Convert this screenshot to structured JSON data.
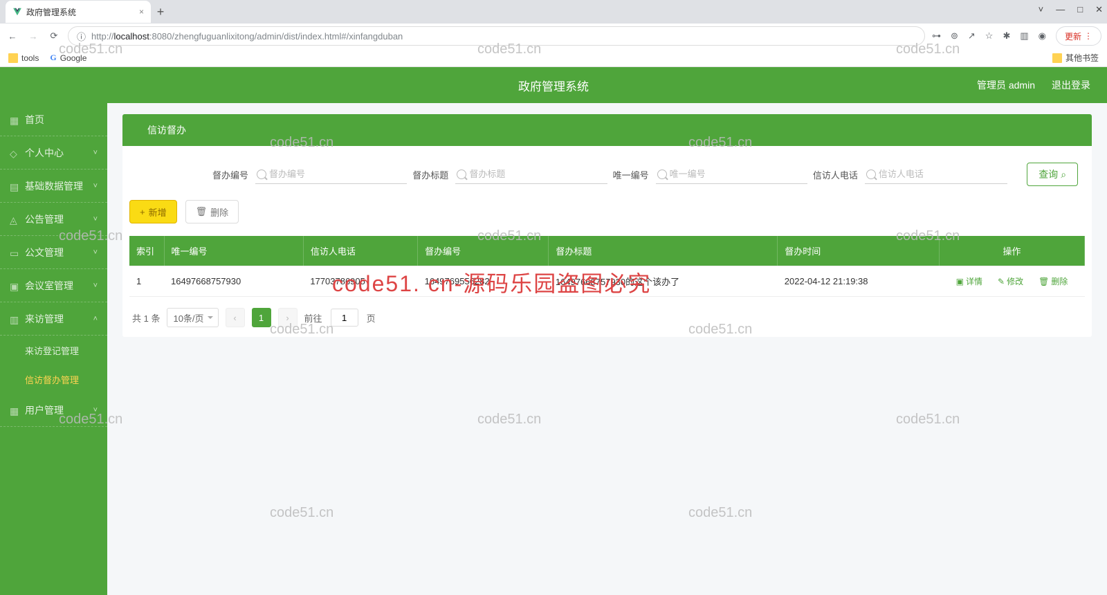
{
  "browser": {
    "tab_title": "政府管理系统",
    "new_tab": "+",
    "url_prefix": "http://",
    "url_host": "localhost",
    "url_port_path": ":8080/zhengfuguanlixitong/admin/dist/index.html#/xinfangduban",
    "bm_tools": "tools",
    "bm_google": "Google",
    "bm_other": "其他书签",
    "update": "更新",
    "win_min": "—",
    "win_max": "□",
    "win_close": "✕",
    "win_down": "˅"
  },
  "header": {
    "title": "政府管理系统",
    "role": "管理员 admin",
    "logout": "退出登录"
  },
  "sidebar": {
    "items": [
      {
        "label": "首页",
        "arrow": ""
      },
      {
        "label": "个人中心",
        "arrow": "˅"
      },
      {
        "label": "基础数据管理",
        "arrow": "˅"
      },
      {
        "label": "公告管理",
        "arrow": "˅"
      },
      {
        "label": "公文管理",
        "arrow": "˅"
      },
      {
        "label": "会议室管理",
        "arrow": "˅"
      },
      {
        "label": "来访管理",
        "arrow": "˄"
      },
      {
        "label": "用户管理",
        "arrow": "˅"
      }
    ],
    "sub": {
      "visit_reg": "来访登记管理",
      "petition": "信访督办管理"
    }
  },
  "panel": {
    "title": "信访督办"
  },
  "search": {
    "f1_label": "督办编号",
    "f1_ph": "督办编号",
    "f2_label": "督办标题",
    "f2_ph": "督办标题",
    "f3_label": "唯一编号",
    "f3_ph": "唯一编号",
    "f4_label": "信访人电话",
    "f4_ph": "信访人电话",
    "query": "查询"
  },
  "actions": {
    "add": "新增",
    "delete": "删除"
  },
  "table": {
    "headers": [
      "索引",
      "唯一编号",
      "信访人电话",
      "督办编号",
      "督办标题",
      "督办时间",
      "操作"
    ],
    "rows": [
      {
        "idx": "1",
        "uid": "16497668757930",
        "phone": "17703786905",
        "no": "1649769556282",
        "title": "16497668757930的这个该办了",
        "time": "2022-04-12 21:19:38"
      }
    ],
    "op_detail": "详情",
    "op_edit": "修改",
    "op_del": "删除"
  },
  "pager": {
    "total": "共 1 条",
    "size": "10条/页",
    "prev": "‹",
    "page1": "1",
    "next": "›",
    "goto": "前往",
    "goto_val": "1",
    "goto_suffix": "页"
  },
  "watermark": "code51.cn",
  "watermark_red": "code51. cn-源码乐园盗图必究"
}
